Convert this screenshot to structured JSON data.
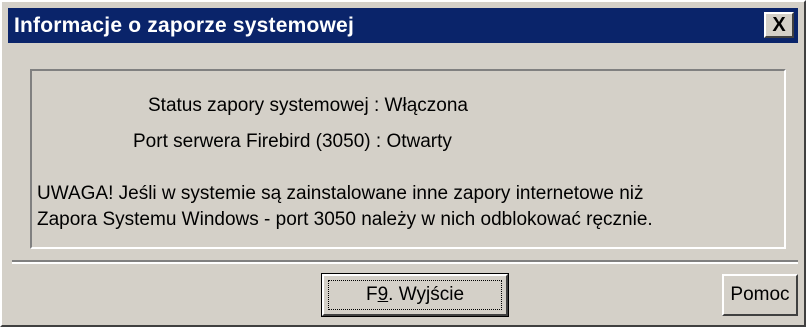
{
  "window": {
    "title": "Informacje o zaporze systemowej",
    "close_label": "X"
  },
  "info": {
    "status_label": "Status zapory systemowej :",
    "status_value": "Włączona",
    "port_label": "Port serwera Firebird (3050) :",
    "port_value": "Otwarty"
  },
  "warning": {
    "line1": "UWAGA!  Jeśli w systemie są zainstalowane inne zapory internetowe niż",
    "line2": "Zapora Systemu Windows - port 3050 należy w nich odblokować ręcznie."
  },
  "buttons": {
    "exit_prefix": "F",
    "exit_underline": "9",
    "exit_suffix": ". Wyjście",
    "help": "Pomoc"
  },
  "colors": {
    "title_bar": "#0a246a",
    "face": "#d4d0c8"
  }
}
